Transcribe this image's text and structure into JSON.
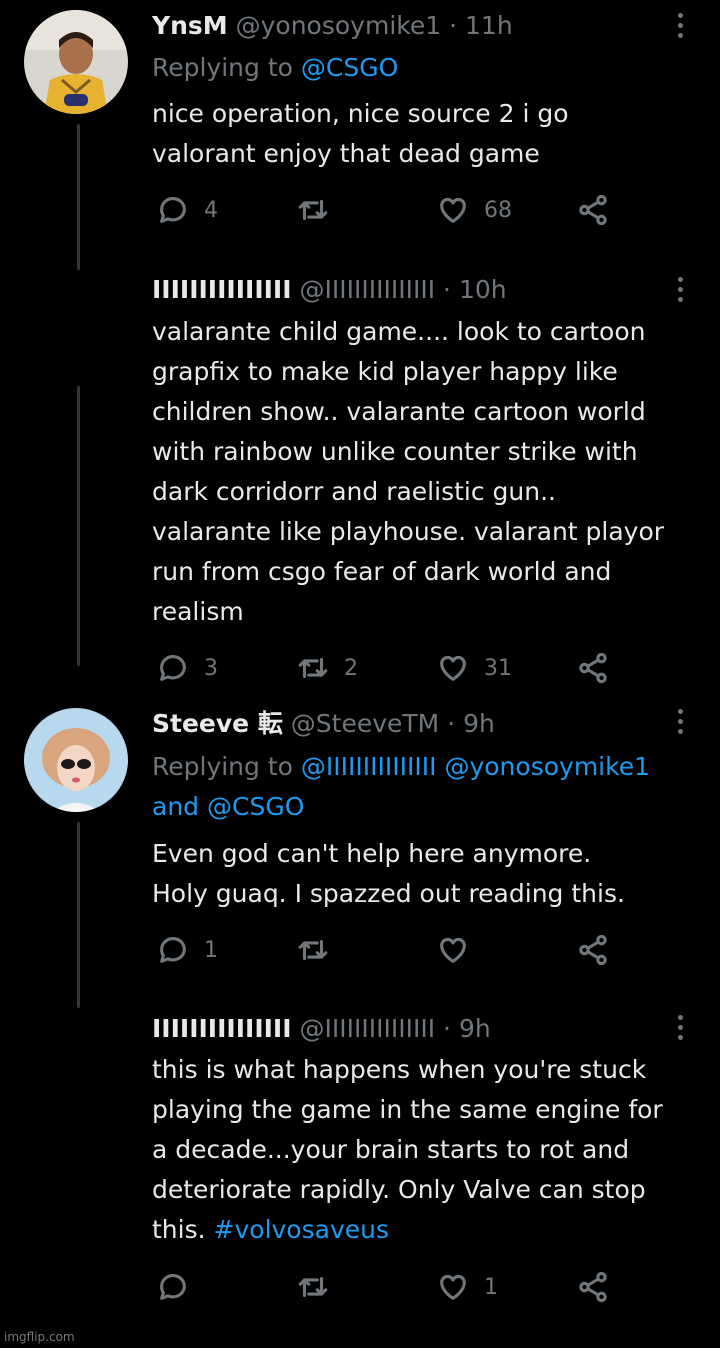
{
  "tweets": [
    {
      "name": "YnsM",
      "handle": "@yonosoymike1",
      "dot": "·",
      "time": "11h",
      "replying_prefix": "Replying to",
      "replying_to": "@CSGO",
      "lines": [
        "nice operation, nice source 2 i go",
        "valorant enjoy that dead game"
      ],
      "replies": "4",
      "retweets": "",
      "likes": "68"
    },
    {
      "name": "IIIIIIIIIIIIIII",
      "handle": "@IIIIIIIIIIIIIII",
      "dot": "·",
      "time": "10h",
      "lines": [
        "valarante child game.... look to cartoon",
        "grapfix to make kid player happy like",
        "children show.. valarante cartoon world",
        "with rainbow unlike counter strike with",
        "dark corridorr and raelistic gun..",
        "valarante like playhouse. valarant playor",
        "run from csgo fear of dark world and",
        "realism"
      ],
      "replies": "3",
      "retweets": "2",
      "likes": "31"
    },
    {
      "name": "Steeve 転",
      "handle": "@SteeveTM",
      "dot": "·",
      "time": "9h",
      "replying_prefix": "Replying to",
      "replying_to_1": "@IIIIIIIIIIIIIII",
      "replying_to_2": "@yonosoymike1",
      "replying_and": "and",
      "replying_to_3": "@CSGO",
      "lines": [
        "Even god can't help here anymore.",
        "Holy guaq. I spazzed out reading this."
      ],
      "replies": "1",
      "retweets": "",
      "likes": ""
    },
    {
      "name": "IIIIIIIIIIIIIII",
      "handle": "@IIIIIIIIIIIIIII",
      "dot": "·",
      "time": "9h",
      "lines": [
        "this is what happens when you're stuck",
        "playing the game in the same engine for",
        "a decade...your brain starts to rot and",
        "deteriorate rapidly. Only Valve can stop"
      ],
      "last_line_prefix": "this.",
      "hashtag": "#volvosaveus",
      "replies": "",
      "retweets": "",
      "likes": "1"
    }
  ],
  "watermark": "imgflip.com",
  "colors": {
    "background": "#000000",
    "text": "#e7e9ea",
    "muted": "#71767b",
    "link": "#1d9bf0"
  }
}
